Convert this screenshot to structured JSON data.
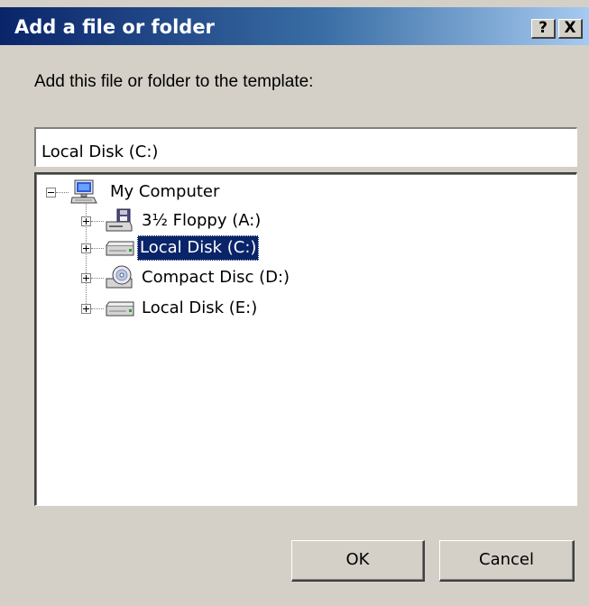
{
  "dialog": {
    "title": "Add a file or folder",
    "help_label": "?",
    "close_label": "X",
    "prompt": "Add this file or folder to the template:",
    "path_value": "Local Disk (C:)",
    "ok_label": "OK",
    "cancel_label": "Cancel"
  },
  "tree": {
    "root": {
      "label": "My Computer",
      "icon": "computer-icon",
      "expanded": true
    },
    "items": [
      {
        "label": "3½ Floppy (A:)",
        "icon": "floppy-drive-icon",
        "selected": false
      },
      {
        "label": "Local Disk (C:)",
        "icon": "hard-disk-icon",
        "selected": true
      },
      {
        "label": "Compact Disc (D:)",
        "icon": "cd-drive-icon",
        "selected": false
      },
      {
        "label": "Local Disk (E:)",
        "icon": "hard-disk-icon",
        "selected": false
      }
    ]
  },
  "colors": {
    "title_gradient_start": "#0a246a",
    "title_gradient_end": "#a6caf0",
    "dialog_face": "#d4d0c8",
    "selection": "#0a246a"
  }
}
